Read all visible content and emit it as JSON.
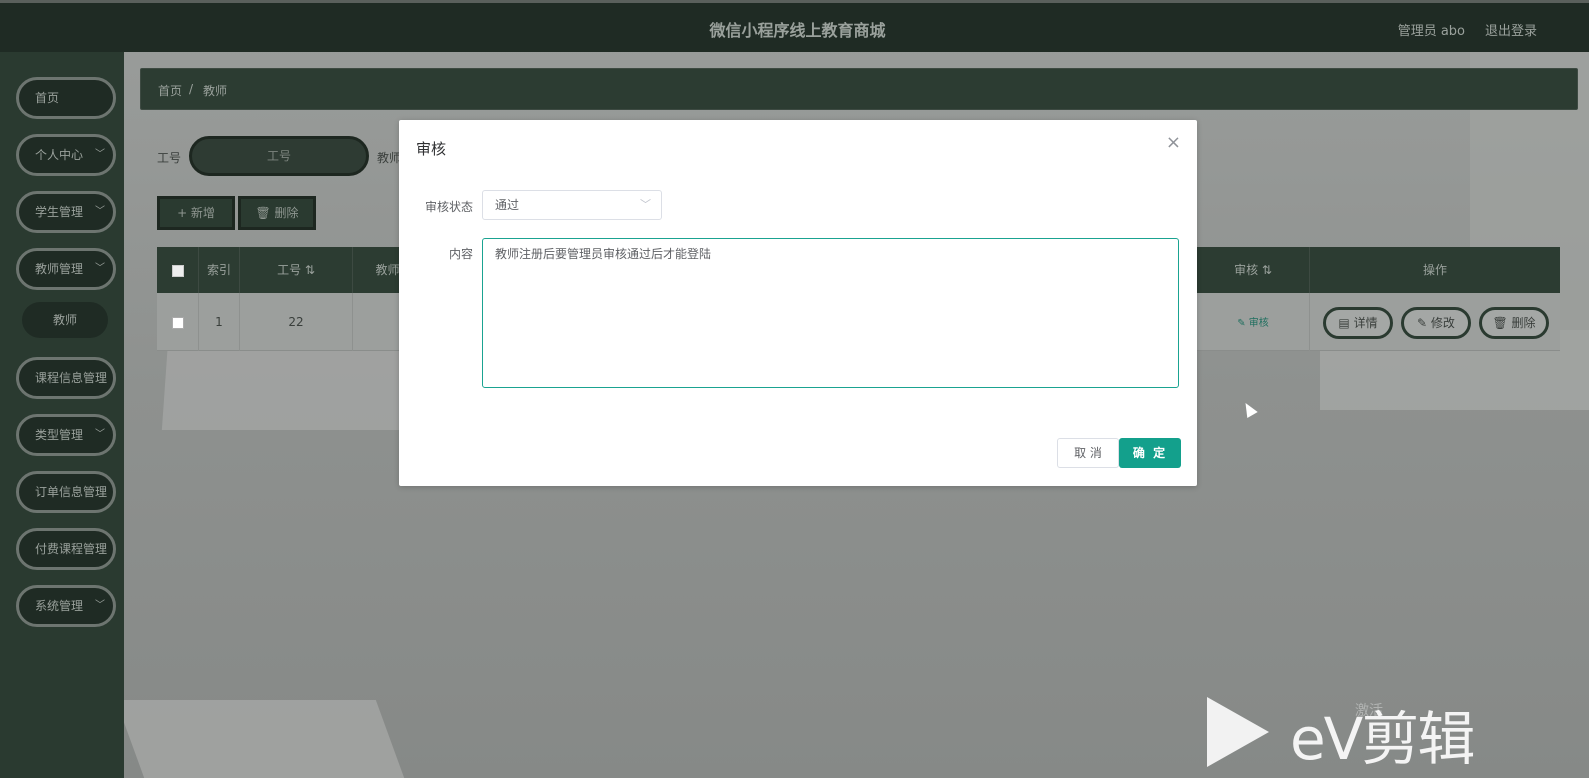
{
  "header": {
    "title": "微信小程序线上教育商城",
    "admin_label": "管理员 abo",
    "logout_label": "退出登录"
  },
  "sidebar": {
    "items": [
      {
        "label": "首页"
      },
      {
        "label": "个人中心"
      },
      {
        "label": "学生管理"
      },
      {
        "label": "教师管理"
      },
      {
        "label": "教师"
      },
      {
        "label": "课程信息管理"
      },
      {
        "label": "类型管理"
      },
      {
        "label": "订单信息管理"
      },
      {
        "label": "付费课程管理"
      },
      {
        "label": "系统管理"
      }
    ]
  },
  "breadcrumb": {
    "home": "首页",
    "sep": "/",
    "current": "教师"
  },
  "search": {
    "gh_label": "工号",
    "gh_placeholder": "工号",
    "js_label": "教师"
  },
  "toolbar": {
    "add_label": "+ 新增",
    "delete_label": "删除"
  },
  "table": {
    "headers": {
      "index": "索引",
      "gh": "工号 ⇅",
      "js": "教师",
      "sh": "审核 ⇅",
      "op": "操作"
    },
    "rows": [
      {
        "index": "1",
        "gh": "22",
        "audit": "审核",
        "detail": "详情",
        "edit": "修改",
        "delete": "删除"
      }
    ]
  },
  "modal": {
    "title": "审核",
    "close": "×",
    "status_label": "审核状态",
    "status_value": "通过",
    "content_label": "内容",
    "content_value": "教师注册后要管理员审核通过后才能登陆",
    "cancel_label": "取 消",
    "ok_label": "确 定"
  },
  "watermark": {
    "brand": "eV剪辑",
    "faint": "激活"
  }
}
